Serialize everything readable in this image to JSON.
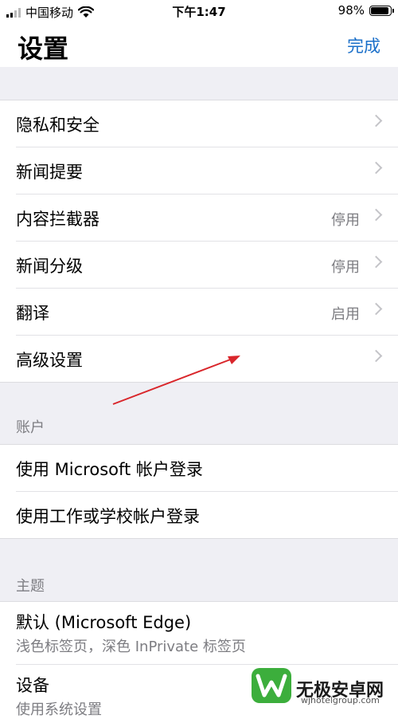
{
  "status": {
    "carrier": "中国移动",
    "time": "下午1:47",
    "battery": "98%"
  },
  "nav": {
    "title": "设置",
    "done": "完成"
  },
  "main_items": [
    {
      "label": "隐私和安全",
      "value": ""
    },
    {
      "label": "新闻提要",
      "value": ""
    },
    {
      "label": "内容拦截器",
      "value": "停用"
    },
    {
      "label": "新闻分级",
      "value": "停用"
    },
    {
      "label": "翻译",
      "value": "启用"
    },
    {
      "label": "高级设置",
      "value": ""
    }
  ],
  "account": {
    "header": "账户",
    "items": [
      {
        "label": "使用 Microsoft 帐户登录"
      },
      {
        "label": "使用工作或学校帐户登录"
      }
    ]
  },
  "theme": {
    "header": "主题",
    "items": [
      {
        "label": "默认 (Microsoft Edge)",
        "sub": "浅色标签页，深色 InPrivate 标签页"
      },
      {
        "label": "设备",
        "sub": "使用系统设置"
      }
    ]
  },
  "watermark": {
    "name": "无极安卓网",
    "url": "wjhotelgroup.com",
    "accent": "#3cae3c"
  },
  "colors": {
    "accent": "#1a6fc9",
    "annotation_arrow": "#d9262b"
  }
}
